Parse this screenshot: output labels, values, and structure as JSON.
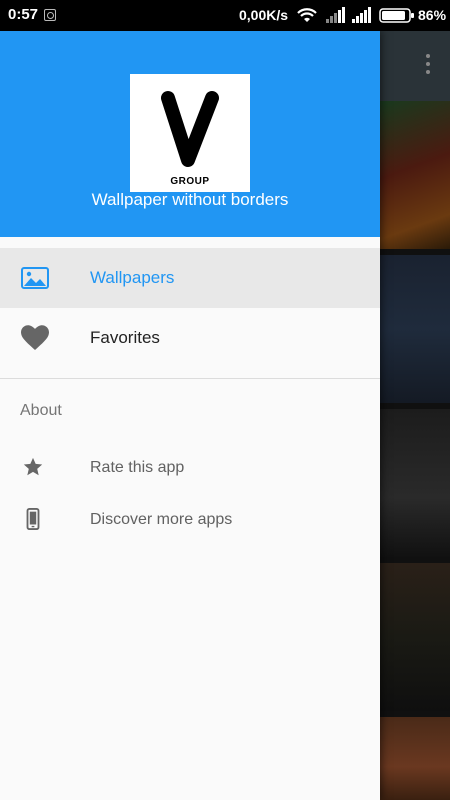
{
  "status_bar": {
    "time": "0:57",
    "network_speed": "0,00K/s",
    "battery": "86%"
  },
  "drawer": {
    "logo_letter": "V",
    "logo_subtext": "GROUP",
    "app_title": "Wallpaper without borders",
    "primary_items": [
      {
        "label": "Wallpapers",
        "icon": "image-icon",
        "selected": true
      },
      {
        "label": "Favorites",
        "icon": "heart-icon",
        "selected": false
      }
    ],
    "section_header": "About",
    "secondary_items": [
      {
        "label": "Rate this app",
        "icon": "star-icon"
      },
      {
        "label": "Discover more apps",
        "icon": "smartphone-icon"
      }
    ]
  },
  "colors": {
    "accent": "#2196f3",
    "selected_bg": "#e8e8e8",
    "drawer_bg": "#fafafa"
  }
}
